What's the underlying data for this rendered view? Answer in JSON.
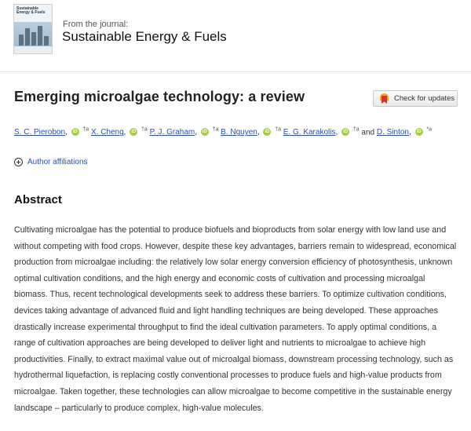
{
  "journal": {
    "from_label": "From the journal:",
    "name": "Sustainable Energy & Fuels",
    "cover_title": "Sustainable Energy & Fuels"
  },
  "article": {
    "title": "Emerging microalgae technology: a review",
    "check_updates_label": "Check for updates"
  },
  "authors": [
    {
      "name": "S. C. Pierobon",
      "marks": "†a"
    },
    {
      "name": "X. Cheng",
      "marks": "†a"
    },
    {
      "name": "P. J. Graham",
      "marks": "†a"
    },
    {
      "name": "B. Nguyen",
      "marks": "†a"
    },
    {
      "name": "E. G. Karakolis",
      "marks": "†a"
    },
    {
      "name": "D. Sinton",
      "marks": "*a"
    }
  ],
  "authors_conjunction": "and",
  "orcid_label": "iD",
  "affiliations_label": "Author affiliations",
  "abstract": {
    "heading": "Abstract",
    "text": "Cultivating microalgae has the potential to produce biofuels and bioproducts from solar energy with low land use and without competing with food crops. However, despite these key advantages, barriers remain to widespread, economical production from microalgae including: the relatively low solar energy conversion efficiency of photosynthesis, unknown optimal cultivation conditions, and the high energy and economic costs of cultivation and processing microalgal biomass. Thus, recent technological developments seek to address these barriers. To optimize cultivation conditions, devices taking advantage of advanced fluid and light handling techniques are being developed. These approaches drastically increase experimental throughput to find the ideal cultivation parameters. To apply optimal conditions, a range of cultivation approaches are being developed to deliver light and nutrients to microalgae to achieve high productivities. Finally, to extract maximal value out of microalgal biomass, downstream processing technology, such as hydrothermal liquefaction, is replacing costly conventional processes to produce fuels and high-value products from microalgae. Taken together, these technologies can allow microalgae to become competitive in the sustainable energy landscape – particularly to produce complex, high-value molecules."
  }
}
